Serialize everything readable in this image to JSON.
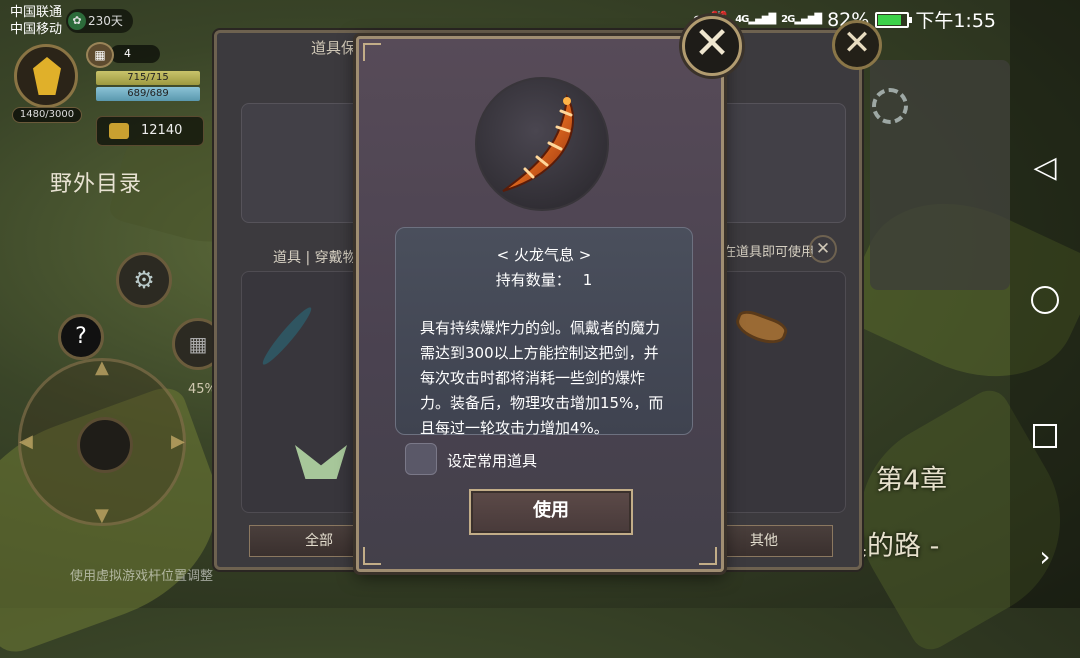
{
  "status_bar": {
    "carrier1": "中国联通",
    "carrier2": "中国移动",
    "days": "230天",
    "battery": "82%",
    "time": "下午1:55",
    "battery_fraction": 0.82,
    "battery_color": "#3dd24a"
  },
  "hud": {
    "exp": "1480/3000",
    "level": "4",
    "hp": "715/715",
    "mp": "689/689",
    "gold": "12140",
    "field_directory": "野外目录",
    "progress": "45%",
    "hint": "使用虚拟游戏杆位置调整"
  },
  "game_text": {
    "chapter": "第4章",
    "path": "巢的路 -"
  },
  "back_panel": {
    "title": "道具保管箱",
    "tab_label": "道具 | 穿戴物品",
    "hint": "在道具即可使用",
    "categories": {
      "all": "全部",
      "other": "其他"
    }
  },
  "popup": {
    "item_name": "< 火龙气息 >",
    "count_label": "持有数量：",
    "count_value": "1",
    "description": "具有持续爆炸力的剑。佩戴者的魔力需达到300以上方能控制这把剑，并每次攻击时都将消耗一些剑的爆炸力。装备后，物理攻击增加15%，而且每过一轮攻击力增加4%。",
    "favorite_label": "设定常用道具",
    "use_button": "使用",
    "accent_color": "#a08e72"
  },
  "icons": {
    "close": "close-icon",
    "back": "back-triangle-icon",
    "home": "home-circle-icon",
    "recent": "recent-square-icon",
    "more": "chevron-right-icon",
    "gold": "gold-icon",
    "gear": "gear-icon",
    "help": "help-icon",
    "calendar": "calendar-icon"
  }
}
